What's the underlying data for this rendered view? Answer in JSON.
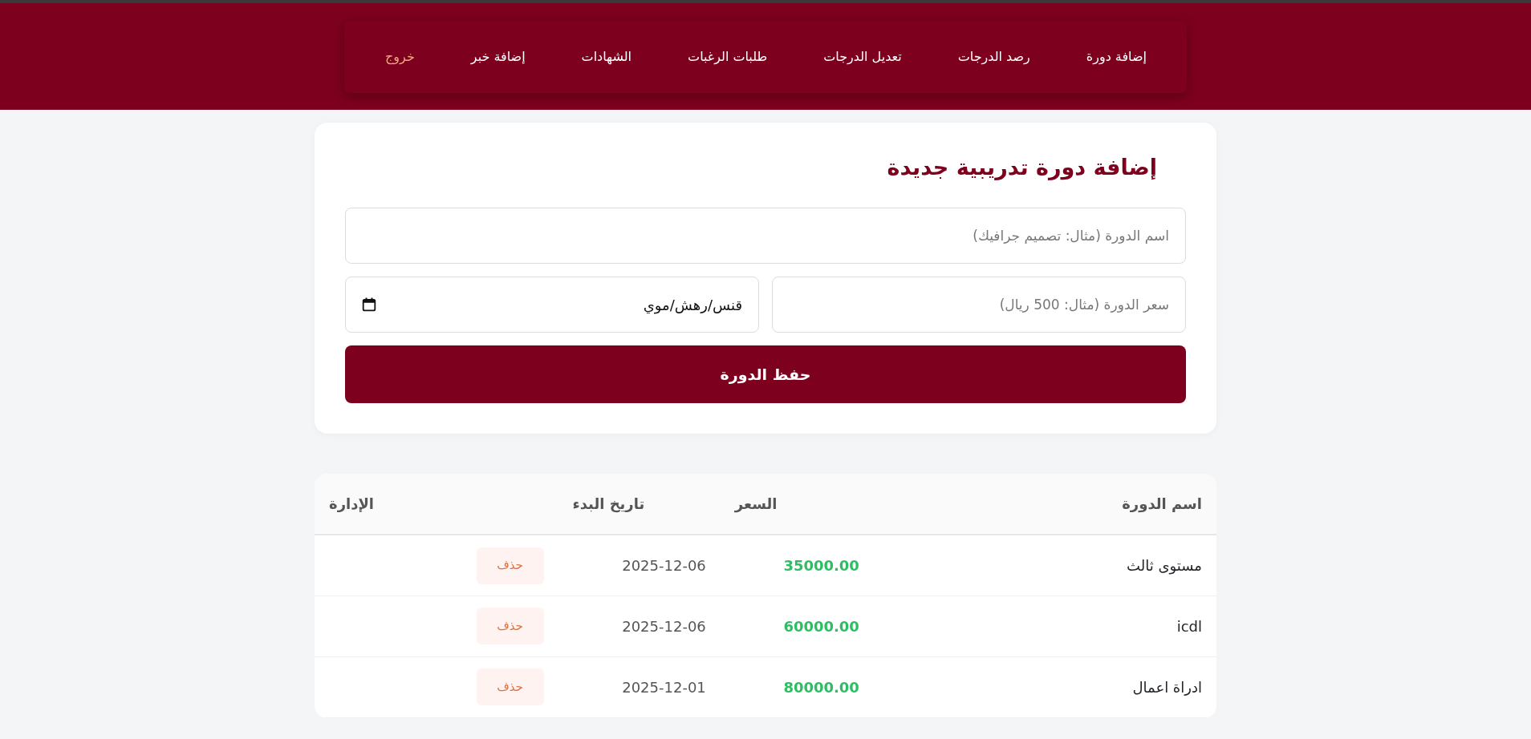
{
  "navbar": {
    "items": [
      {
        "label": "إضافة دورة",
        "kind": "link"
      },
      {
        "label": "رصد الدرجات",
        "kind": "link"
      },
      {
        "label": "تعديل الدرجات",
        "kind": "link"
      },
      {
        "label": "طلبات الرغبات",
        "kind": "link"
      },
      {
        "label": "الشهادات",
        "kind": "link"
      },
      {
        "label": "إضافة خبر",
        "kind": "link"
      },
      {
        "label": "خروج",
        "kind": "logout"
      }
    ]
  },
  "form": {
    "title": "إضافة دورة تدريبية جديدة",
    "name_field": {
      "placeholder": "اسم الدورة (مثال: تصميم جرافيك)"
    },
    "price_field": {
      "placeholder": "سعر الدورة (مثال: 500 ريال)"
    },
    "date_field": {
      "value": "قنس/رهش/موي"
    },
    "submit": "حفظ الدورة"
  },
  "table": {
    "columns": [
      "اسم الدورة",
      "السعر",
      "تاريخ البدء",
      "الإدارة"
    ],
    "rows": [
      {
        "name": "مستوى ثالث",
        "price": "35000.00",
        "date": "2025-12-06",
        "action": "حذف"
      },
      {
        "name": "icdl",
        "price": "60000.00",
        "date": "2025-12-06",
        "action": "حذف"
      },
      {
        "name": "ادراة اعمال",
        "price": "80000.00",
        "date": "2025-12-01",
        "action": "حذف"
      }
    ]
  }
}
